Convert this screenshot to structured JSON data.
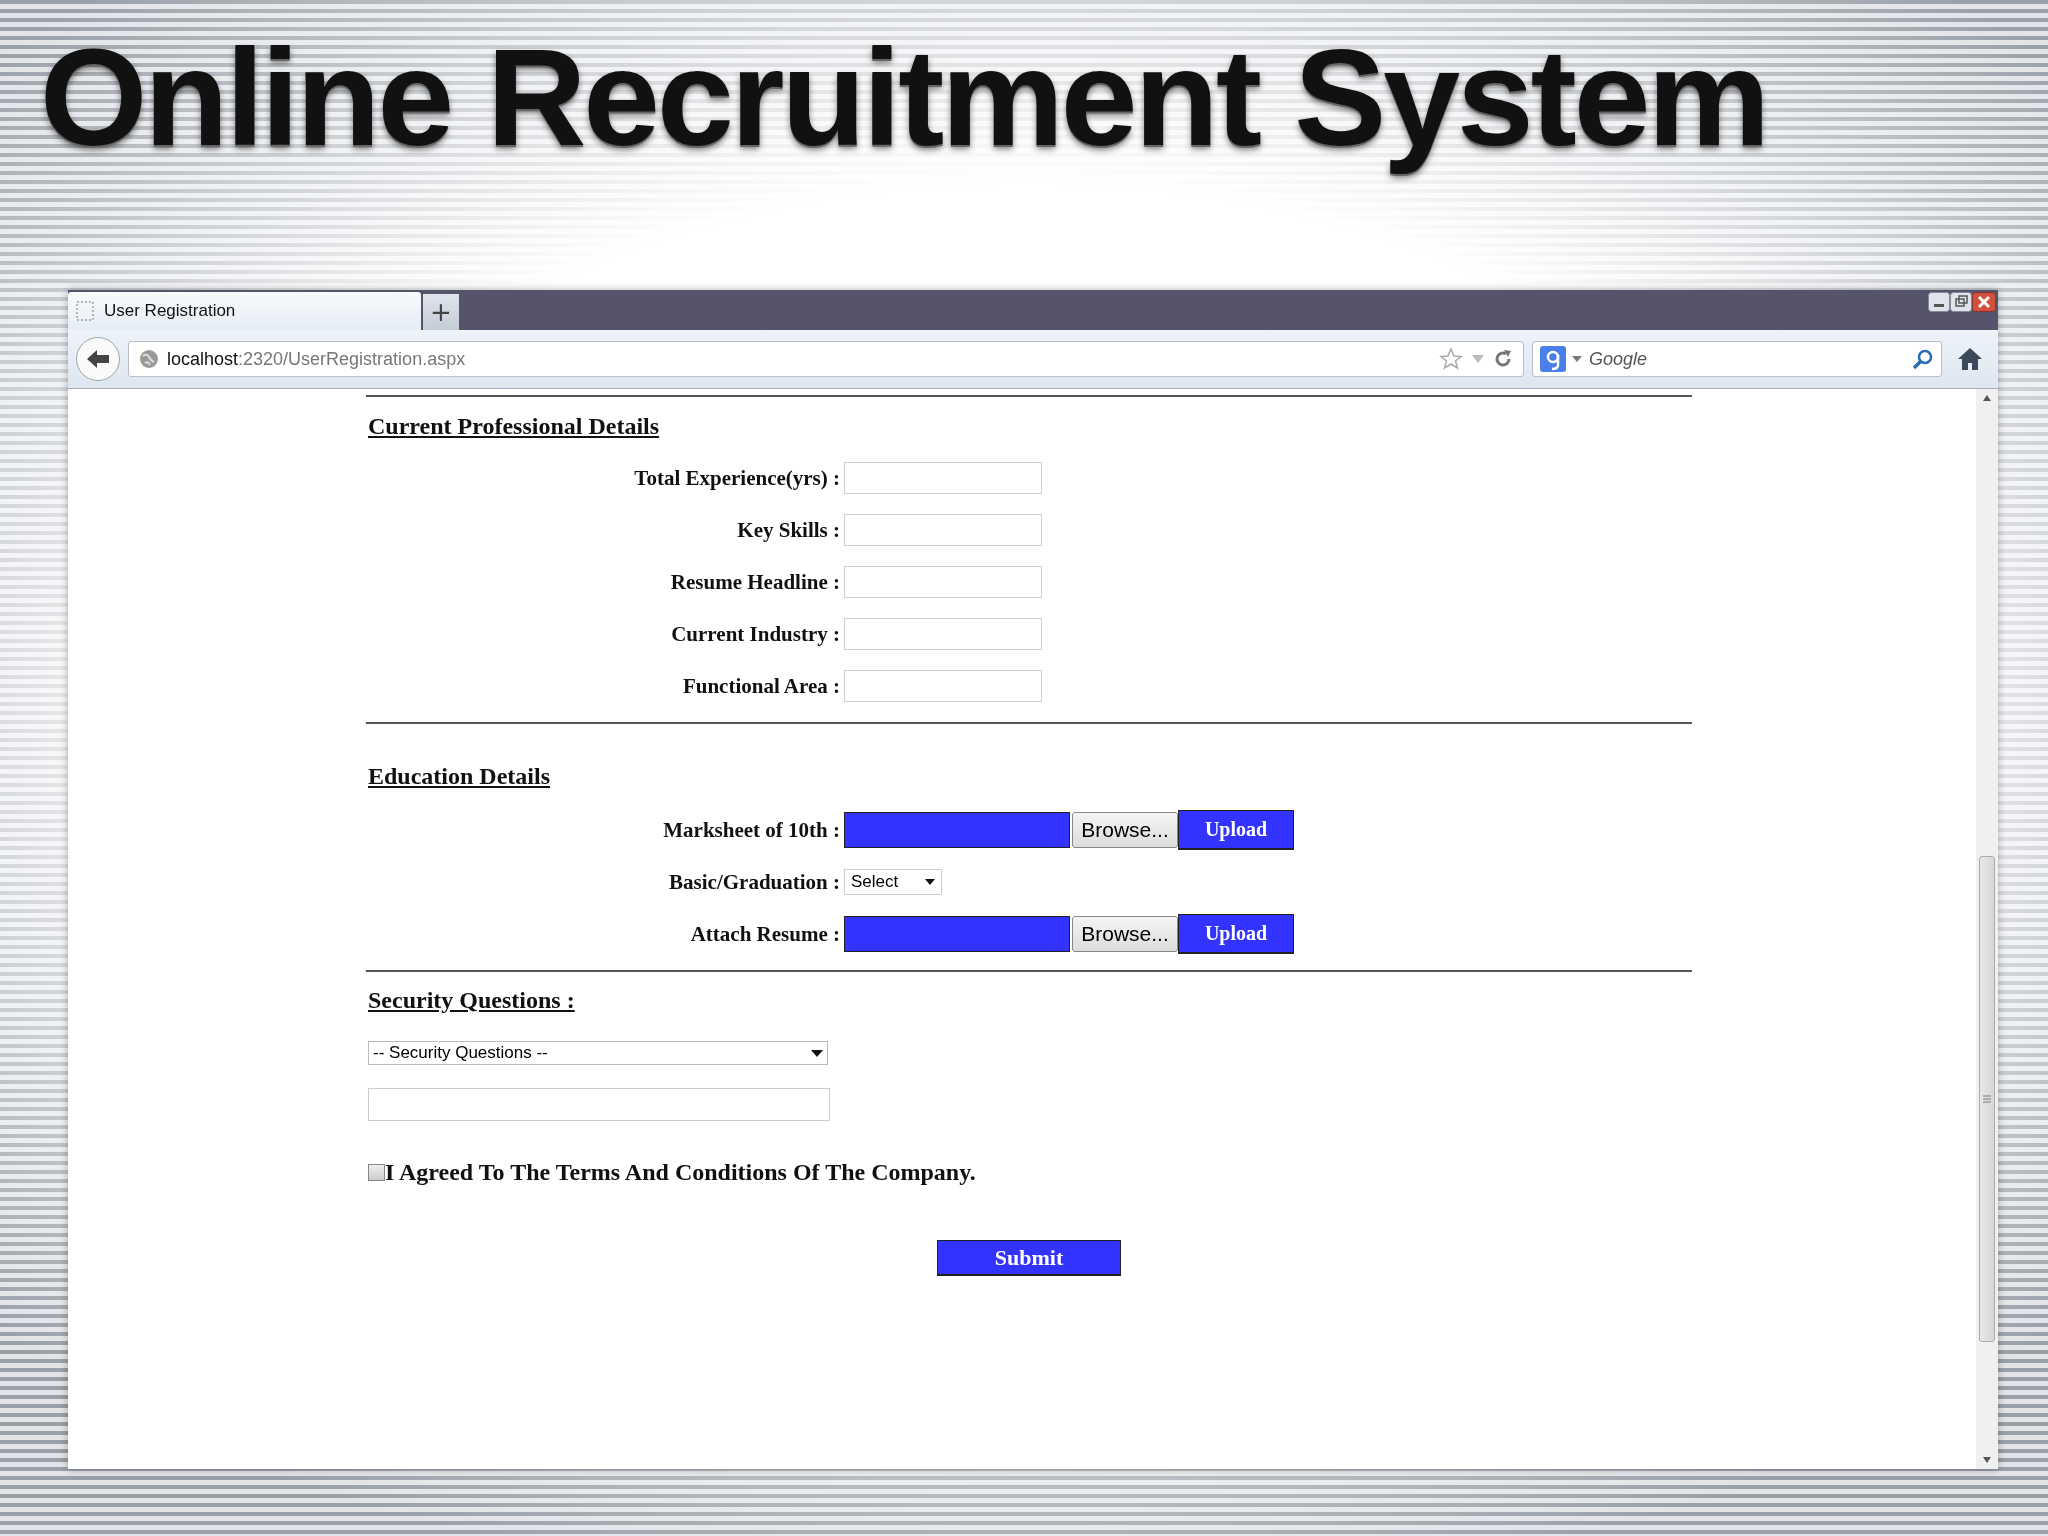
{
  "slide_title": "Online Recruitment System",
  "browser": {
    "tab": {
      "title": "User Registration"
    },
    "new_tab": "+",
    "address": {
      "host": "localhost",
      "path": ":2320/UserRegistration.aspx"
    },
    "search": {
      "placeholder": "Google"
    }
  },
  "sections": [
    {
      "heading": "Current Professional Details",
      "fields": [
        {
          "kind": "text",
          "label": "Total Experience(yrs) :"
        },
        {
          "kind": "text",
          "label": "Key Skills :"
        },
        {
          "kind": "text",
          "label": "Resume Headline :"
        },
        {
          "kind": "text",
          "label": "Current Industry :"
        },
        {
          "kind": "text",
          "label": "Functional Area :"
        }
      ]
    },
    {
      "heading": "Education Details",
      "fields": [
        {
          "kind": "file",
          "label": "Marksheet of 10th :",
          "browse": "Browse...",
          "upload": "Upload"
        },
        {
          "kind": "select",
          "label": "Basic/Graduation :",
          "value": "Select"
        },
        {
          "kind": "file",
          "label": "Attach Resume :",
          "browse": "Browse...",
          "upload": "Upload"
        }
      ]
    }
  ],
  "security": {
    "heading": "Security Questions :",
    "select": "-- Security Questions --"
  },
  "terms": {
    "label": "I Agreed To The Terms And Conditions Of The Company.",
    "checked": false
  },
  "submit": "Submit"
}
